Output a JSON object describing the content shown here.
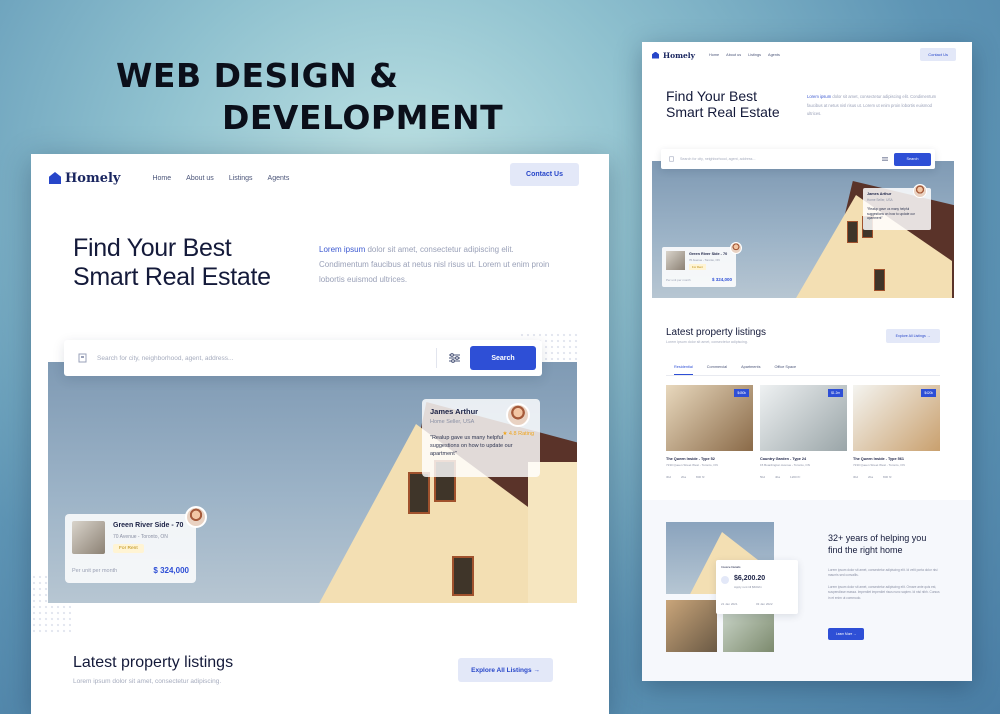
{
  "banner": {
    "line1": "WEB DESIGN &",
    "line2": "DEVELOPMENT"
  },
  "site": {
    "brand": "Homely",
    "nav": [
      "Home",
      "About us",
      "Listings",
      "Agents"
    ],
    "contact": "Contact Us",
    "hero": {
      "title_line1": "Find Your Best",
      "title_line2": "Smart Real Estate",
      "desc_lead": "Lorem ipsum",
      "desc_rest": " dolor sit amet, consectetur adipiscing elit. Condimentum faucibus at netus nisl risus ut. Lorem ut enim proin lobortis euismod ultrices."
    },
    "search": {
      "placeholder": "Search for city, neighborhood, agent, address...",
      "button": "Search"
    },
    "agent": {
      "name": "James Arthur",
      "role": "Home Seller, USA",
      "rating": "★ 4.8 Rating",
      "quote": "\"Realup gave us many helpful suggestions on how to update our apartment\""
    },
    "featured": {
      "title": "Green River Side - 70",
      "address": "70 Avenue - Toronto, ON",
      "tag": "For Rent",
      "per_unit": "Per unit per month",
      "price": "$ 324,000"
    },
    "latest": {
      "title": "Latest property listings",
      "subtitle": "Lorem ipsum dolor sit amet, consectetur adipiscing.",
      "explore": "Explore All Listings →"
    },
    "tabs": [
      "Residential",
      "Commercial",
      "Apartments",
      "Office Space"
    ],
    "cards": [
      {
        "badge": "$450k",
        "title": "The Queen Inside - Type 52",
        "address": "7230 Queen Street West - Toronto, ON",
        "beds": "3bd",
        "baths": "2ba",
        "area": "800 ft²"
      },
      {
        "badge": "$1.2m",
        "title": "Country Garden - Type 24",
        "address": "15 Boardington Avenue - Toronto, ON",
        "beds": "5bd",
        "baths": "4ba",
        "area": "1200 ft²"
      },
      {
        "badge": "$420k",
        "title": "The Queen Inside - Type 561",
        "address": "7230 Queen Street West - Toronto, ON",
        "beds": "3bd",
        "baths": "2ba",
        "area": "800 ft²"
      }
    ],
    "years": {
      "title_line1": "32+ years of helping you",
      "title_line2": "find the right home",
      "desc1": "Lorem ipsum dolor sit amet, consectetur adipiscing elit. Id velit porta dolor nisi maurris sed convallis.",
      "desc2": "Lorem ipsum dolor sit amet, consectetur adipiscing elit. Ornare ante quis est, suspendisse massa. Imperdiet imperdiet risus nunc sapien. Id nisl nibh. Cursus in et enim ut commodo.",
      "button": "Learn More →"
    },
    "invoice": {
      "label": "Invoice Details",
      "amount": "$6,200.20",
      "sub": "Apply rent till $600/m",
      "date1": "21 Jan 2021",
      "date2": "03 Jan 2022"
    }
  },
  "colors": {
    "accent": "#2e4fd6",
    "navy": "#141a3a",
    "gold": "#f0a51b"
  }
}
